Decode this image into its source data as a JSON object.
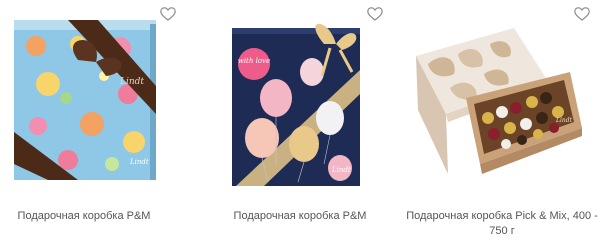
{
  "products": [
    {
      "name": "Подарочная коробка P&M",
      "favorite_icon": "heart-outline-icon",
      "image": "floral-blue-box-with-brown-ribbon"
    },
    {
      "name": "Подарочная коробка P&M",
      "favorite_icon": "heart-outline-icon",
      "image": "navy-box-with-balloons-and-gold-bow",
      "box_badge": "with love"
    },
    {
      "name": "Подарочная коробка Pick & Mix, 400 - 750 г",
      "favorite_icon": "heart-outline-icon",
      "image": "open-leaf-pattern-box-with-chocolates"
    }
  ],
  "brand_marks": [
    "Lindt",
    "Lindt",
    "Lindt"
  ],
  "colors": {
    "text": "#555555",
    "heart": "#8a8a8a",
    "box1_background": "#8fc7e6",
    "box1_ribbon": "#4b2a18",
    "box2_background": "#1e2c55",
    "box2_bow": "#e9c98a",
    "box3_lid": "#efe7dd",
    "box3_base": "#caa27a"
  }
}
